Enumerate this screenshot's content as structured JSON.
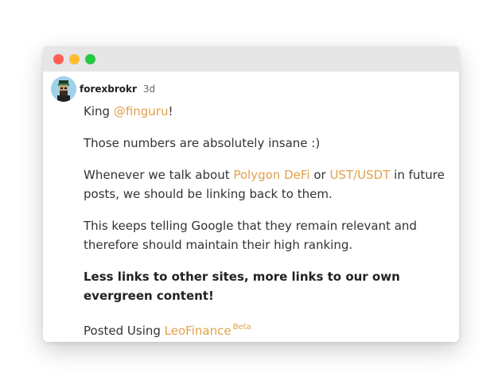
{
  "window": {
    "buttons": [
      "close",
      "minimize",
      "maximize"
    ]
  },
  "post": {
    "author": "forexbrokr",
    "time": "3d",
    "line1": {
      "prefix": "King ",
      "mention": "@finguru",
      "suffix": "!"
    },
    "line2": "Those numbers are absolutely insane :)",
    "line3": {
      "t1": "Whenever we talk about ",
      "link1": "Polygon DeFi",
      "t2": " or ",
      "link2": "UST/USDT",
      "t3": " in future posts, we should be linking back to them."
    },
    "line4": "This keeps telling Google that they remain relevant and therefore should maintain their high ranking.",
    "line5": "Less links to other sites, more links to our own evergreen content!",
    "footer": {
      "prefix": "Posted Using ",
      "app": "LeoFinance",
      "badge": "Beta"
    }
  },
  "colors": {
    "link": "#e3a04a",
    "titlebar": "#e6e6e6"
  }
}
